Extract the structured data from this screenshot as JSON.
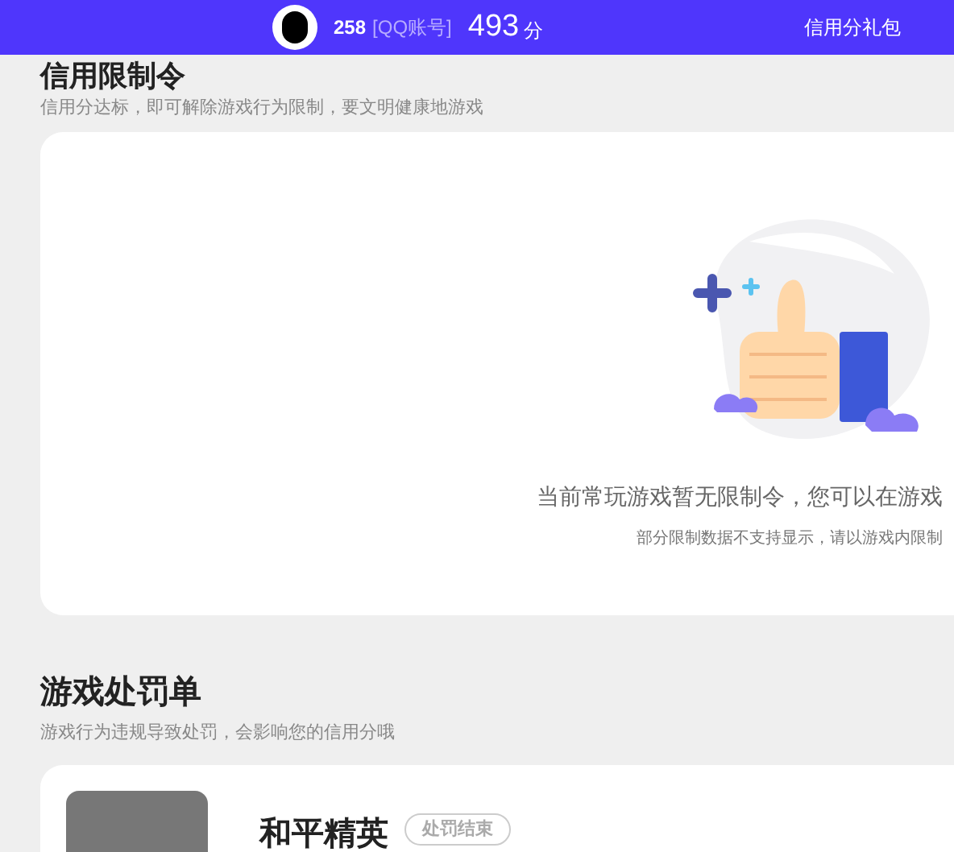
{
  "header": {
    "qq_number": "258",
    "account_type": "[QQ账号]",
    "score": "493",
    "score_unit": "分",
    "gift_link": "信用分礼包"
  },
  "restrictions": {
    "title": "信用限制令",
    "subtitle": "信用分达标，即可解除游戏行为限制，要文明健康地游戏",
    "empty_message": "当前常玩游戏暂无限制令，您可以在游戏",
    "note": "部分限制数据不支持显示，请以游戏内限制"
  },
  "penalties": {
    "title": "游戏处罚单",
    "subtitle": "游戏行为违规导致处罚，会影响您的信用分哦",
    "items": [
      {
        "game": "和平精英",
        "status": "处罚结束"
      }
    ]
  }
}
